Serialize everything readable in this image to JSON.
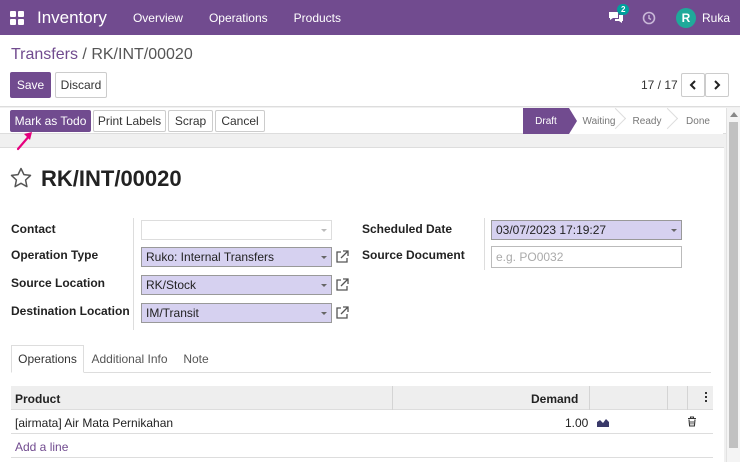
{
  "navbar": {
    "app_title": "Inventory",
    "menu": [
      "Overview",
      "Operations",
      "Products"
    ],
    "chat_badge": "2",
    "avatar_letter": "R",
    "user_name": "Ruka",
    "color": "#714b8f"
  },
  "breadcrumb": {
    "parent": "Transfers",
    "separator": " / ",
    "current": "RK/INT/00020"
  },
  "actions": {
    "save": "Save",
    "discard": "Discard"
  },
  "pager": {
    "value": "17 / 17",
    "prev": "‹",
    "next": "›"
  },
  "statusbar": {
    "buttons": [
      "Mark as Todo",
      "Print Labels",
      "Scrap",
      "Cancel"
    ],
    "stages": [
      "Draft",
      "Waiting",
      "Ready",
      "Done"
    ],
    "active_stage": "Draft"
  },
  "form": {
    "title": "RK/INT/00020",
    "contact_label": "Contact",
    "contact_value": "",
    "operation_type_label": "Operation Type",
    "operation_type_value": "Ruko: Internal Transfers",
    "source_location_label": "Source Location",
    "source_location_value": "RK/Stock",
    "destination_location_label": "Destination Location",
    "destination_location_value": "IM/Transit",
    "scheduled_date_label": "Scheduled Date",
    "scheduled_date_value": "03/07/2023 17:19:27",
    "source_document_label": "Source Document",
    "source_document_placeholder": "e.g. PO0032"
  },
  "tabs": [
    "Operations",
    "Additional Info",
    "Note"
  ],
  "table": {
    "headers": {
      "product": "Product",
      "demand": "Demand"
    },
    "rows": [
      {
        "product": "[airmata] Air Mata Pernikahan",
        "demand": "1.00"
      }
    ],
    "add_line": "Add a line"
  },
  "icons": {
    "apps": "apps-grid-icon",
    "chat": "chat-icon",
    "activity": "clock-icon",
    "favorite": "star-icon",
    "external": "external-link-icon",
    "forecast": "area-chart-icon",
    "delete": "trash-icon",
    "optional_columns": "kebab-icon",
    "annotation": "pointer-arrow-icon"
  },
  "colors": {
    "primary": "#714b8f",
    "required_field": "#d6d1f0",
    "annotation_arrow": "#e6007e",
    "badge": "#00a09d"
  }
}
